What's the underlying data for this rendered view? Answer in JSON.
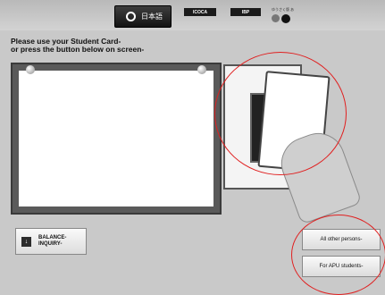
{
  "topbar": {
    "language_button_label": "日本語",
    "icoca_label": "ICOCA",
    "ibp_label": "IBP",
    "toggle_label": "ゆうさく版 あ"
  },
  "instruction": {
    "line1": "Please use your Student Card-",
    "line2": "or press the button below on screen-"
  },
  "buttons": {
    "balance_line1": "BALANCE-",
    "balance_line2": "INQUIRY-",
    "all_other": "All other persons-",
    "apu": "For APU students-"
  },
  "colors": {
    "highlight_circle": "#e02020"
  }
}
